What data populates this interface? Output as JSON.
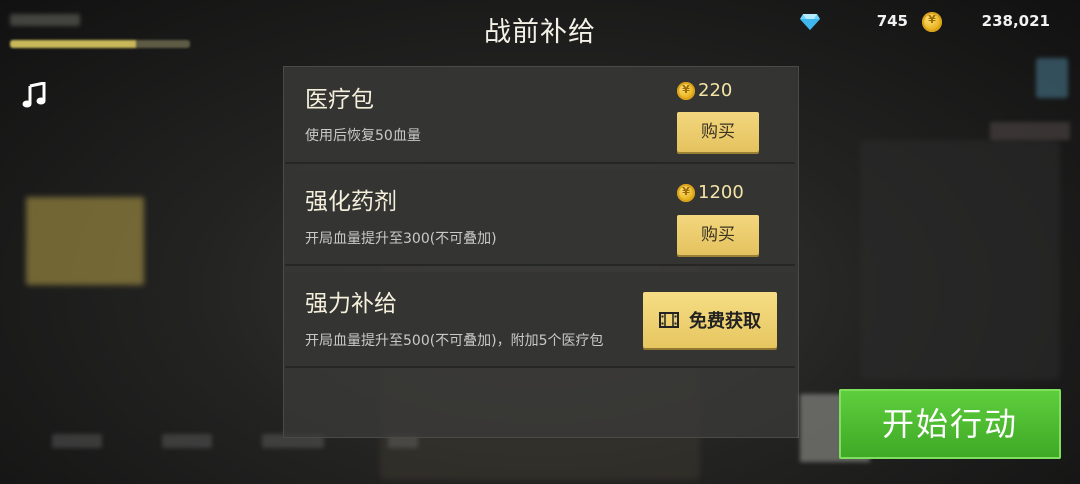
{
  "header": {
    "title": "战前补给",
    "gems": "745",
    "coins": "238,021",
    "player_xp_fraction": 0.7
  },
  "icons": {
    "music": "music-note-icon",
    "gem": "diamond-icon",
    "coin": "coin-icon",
    "video": "film-icon"
  },
  "items": [
    {
      "name": "医疗包",
      "desc": "使用后恢复50血量",
      "price": "220",
      "button": "购买"
    },
    {
      "name": "强化药剂",
      "desc": "开局血量提升至300(不可叠加)",
      "price": "1200",
      "button": "购买"
    },
    {
      "name": "强力补给",
      "desc": "开局血量提升至500(不可叠加)，附加5个医疗包",
      "button": "免费获取"
    }
  ],
  "start_button": "开始行动",
  "colors": {
    "accent_gold": "#e8c862",
    "start_green": "#4cbb2f",
    "panel_bg": "#343433"
  }
}
